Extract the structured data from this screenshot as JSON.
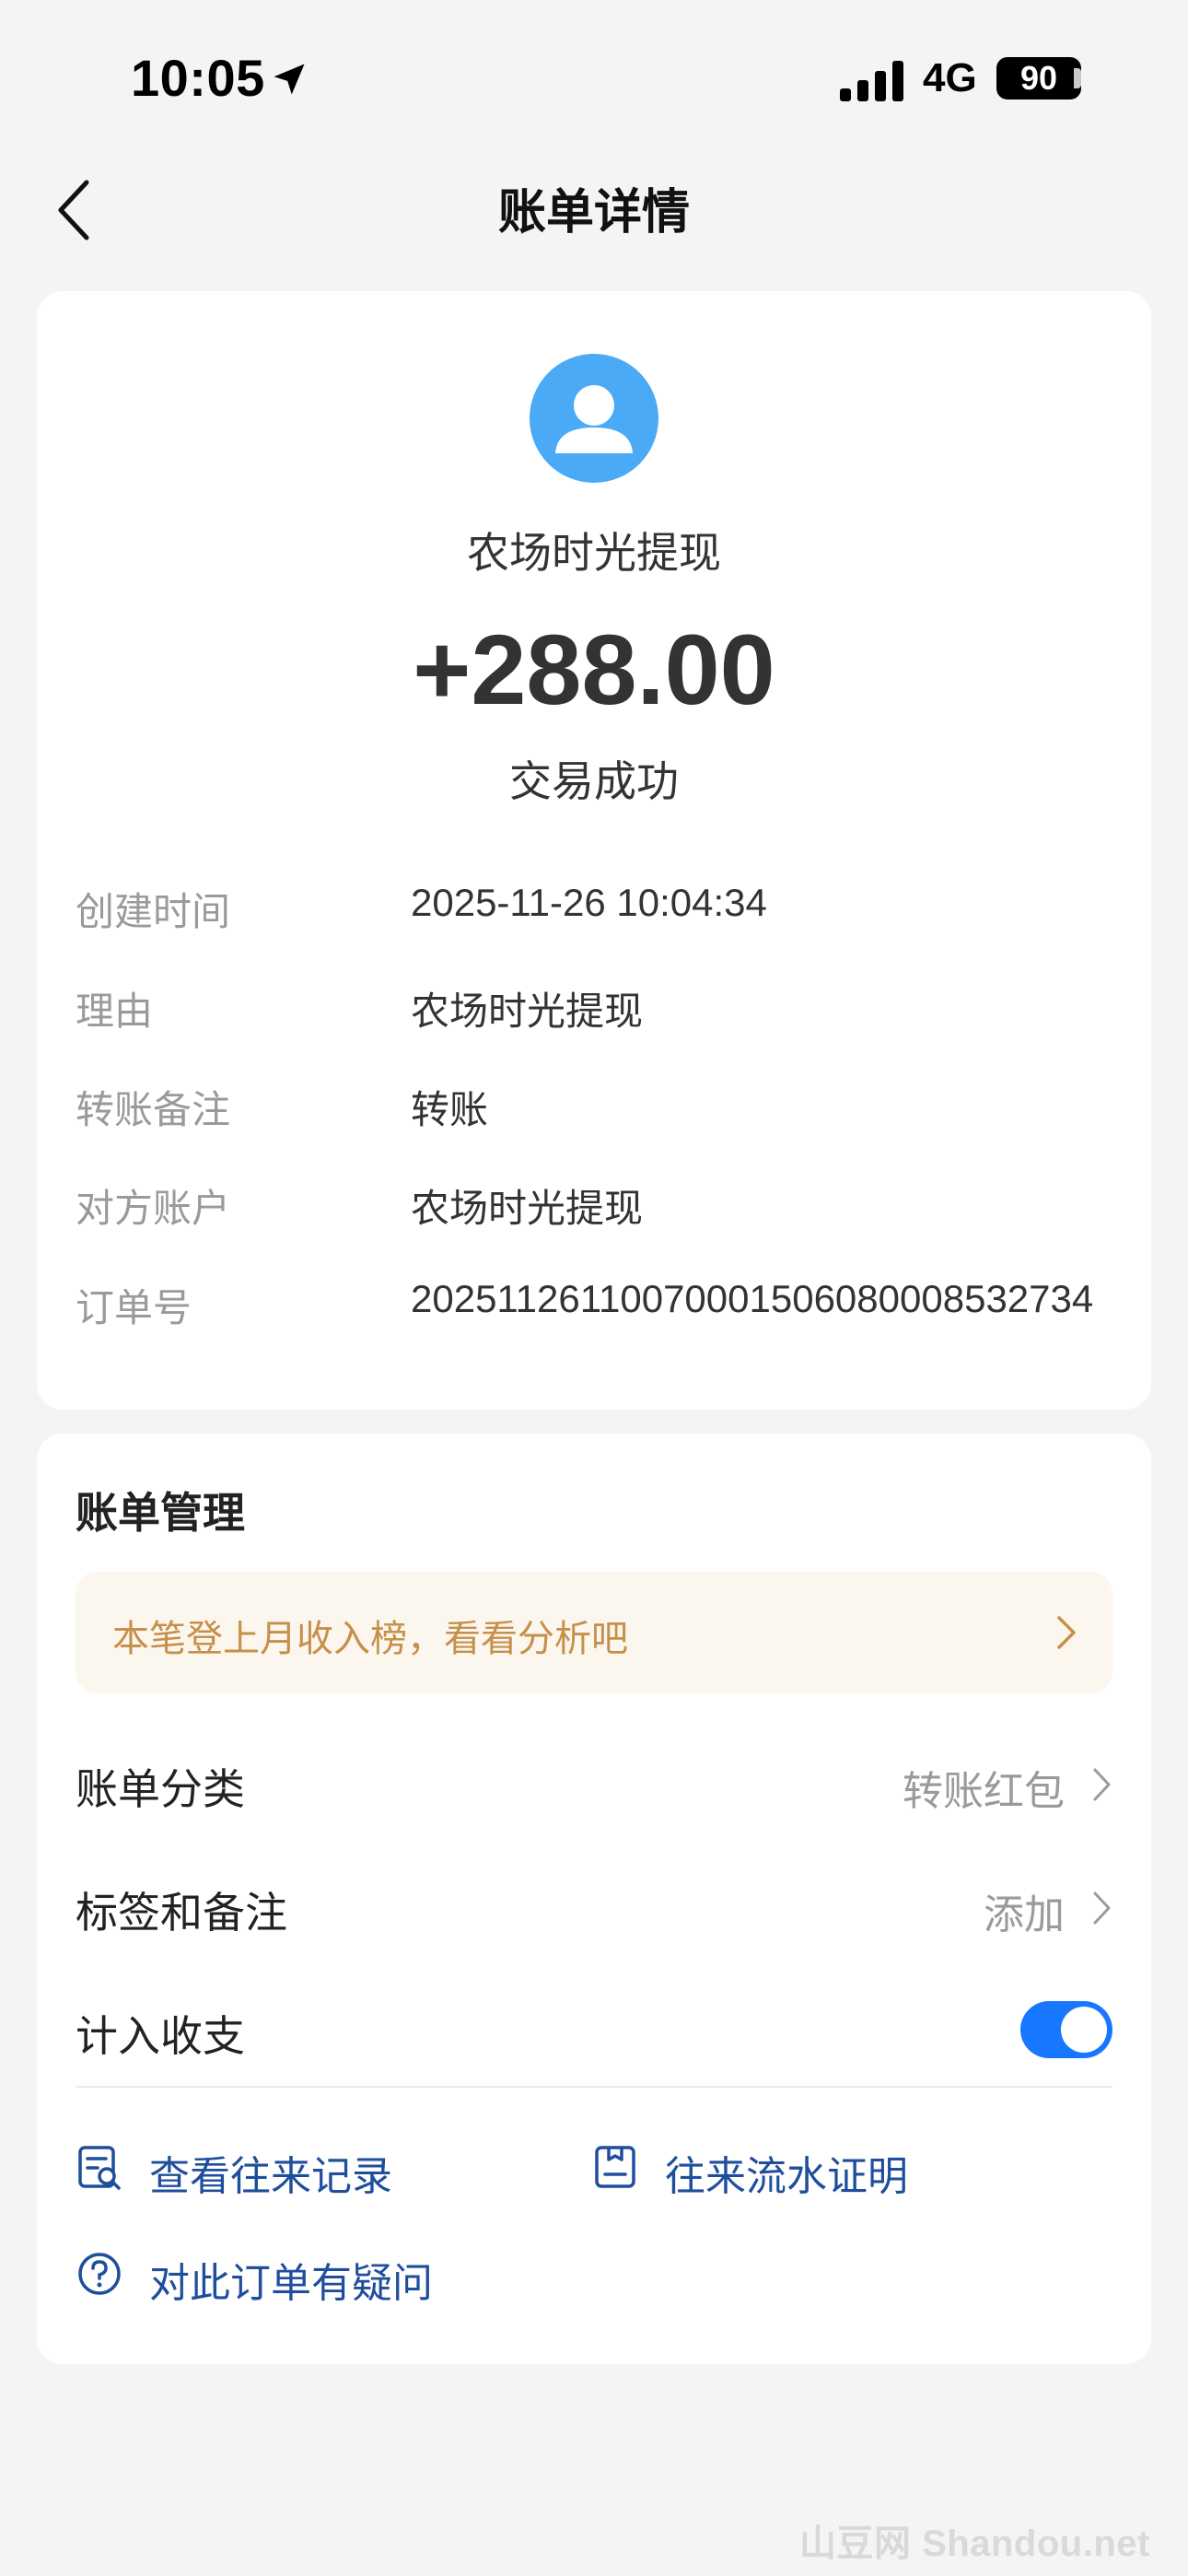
{
  "status_bar": {
    "time": "10:05",
    "network": "4G",
    "battery": "90"
  },
  "nav": {
    "title": "账单详情"
  },
  "transaction": {
    "payee": "农场时光提现",
    "amount": "+288.00",
    "status": "交易成功",
    "details": [
      {
        "label": "创建时间",
        "value": "2025-11-26 10:04:34"
      },
      {
        "label": "理由",
        "value": "农场时光提现"
      },
      {
        "label": "转账备注",
        "value": "转账"
      },
      {
        "label": "对方账户",
        "value": "农场时光提现"
      },
      {
        "label": "订单号",
        "value": "2025112611007000150608000 8532734"
      }
    ]
  },
  "management": {
    "title": "账单管理",
    "tip": "本笔登上月收入榜，看看分析吧",
    "category_label": "账单分类",
    "category_value": "转账红包",
    "tags_label": "标签和备注",
    "tags_value": "添加",
    "include_label": "计入收支",
    "include_on": true,
    "history_link": "查看往来记录",
    "proof_link": "往来流水证明",
    "question_link": "对此订单有疑问"
  },
  "watermark": "山豆网 Shandou.net",
  "colors": {
    "accent": "#1777ff",
    "avatar": "#4aaaf6",
    "link": "#1f4e9c",
    "tip_text": "#c7904a",
    "tip_bg": "#fbf6ee"
  }
}
